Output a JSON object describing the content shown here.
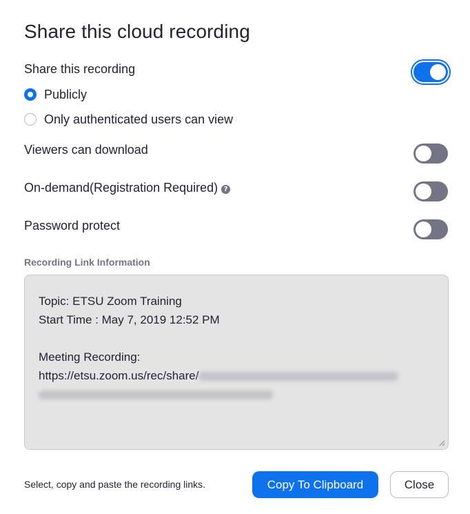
{
  "dialog": {
    "title": "Share this cloud recording"
  },
  "share": {
    "label": "Share this recording",
    "enabled": true,
    "options": [
      {
        "label": "Publicly",
        "checked": true
      },
      {
        "label": "Only authenticated users can view",
        "checked": false
      }
    ]
  },
  "settings": [
    {
      "label": "Viewers can download",
      "enabled": false
    },
    {
      "label": "On-demand(Registration Required)",
      "enabled": false,
      "help_icon": "question-circle-icon"
    },
    {
      "label": "Password protect",
      "enabled": false
    }
  ],
  "link_info": {
    "section_label": "Recording Link Information",
    "topic_line": "Topic: ETSU Zoom Training",
    "start_time_line": "Start Time : May 7, 2019 12:52 PM",
    "recording_label": "Meeting Recording:",
    "url_prefix": "https://etsu.zoom.us/rec/share/"
  },
  "footer": {
    "hint": "Select, copy and paste the recording links.",
    "copy_label": "Copy To Clipboard",
    "close_label": "Close"
  },
  "colors": {
    "accent": "#0e72ed",
    "toggle_off": "#747487",
    "text": "#232333",
    "box_bg": "#e4e4e4"
  }
}
